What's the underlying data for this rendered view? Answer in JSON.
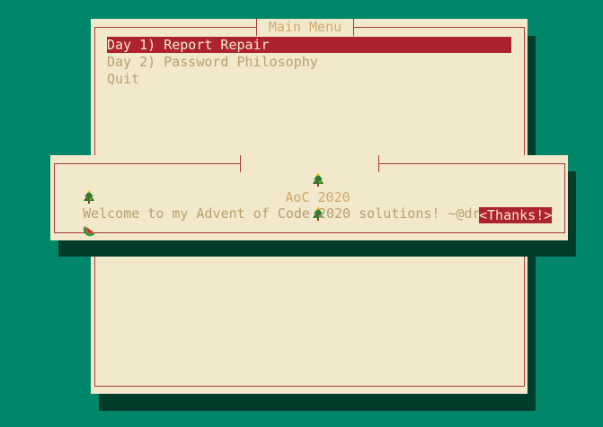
{
  "main_menu": {
    "title": "Main Menu",
    "items": [
      {
        "label": "Day 1) Report Repair",
        "selected": true
      },
      {
        "label": "Day 2) Password Philosophy",
        "selected": false
      },
      {
        "label": "Quit",
        "selected": false
      }
    ]
  },
  "dialog": {
    "title": "AoC 2020",
    "message": "Welcome to my Advent of Code 2020 solutions! ~@drmelon",
    "button_label": "<Thanks!>"
  },
  "colors": {
    "background": "#008769",
    "panel": "#f2e8cc",
    "border": "#a43a3a",
    "text": "#b9a070",
    "title_text": "#d3a96a",
    "highlight": "#ad222f",
    "highlight_text": "#f7ead2",
    "shadow": "#023d2c"
  },
  "icons": {
    "title_left": "christmas-tree-icon",
    "title_right": "christmas-tree-icon",
    "message_left": "christmas-tree-icon",
    "message_right": "watermelon-icon"
  }
}
